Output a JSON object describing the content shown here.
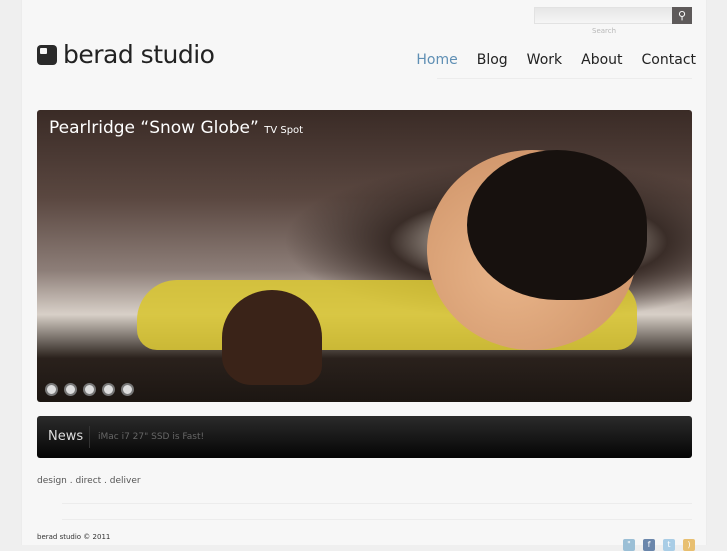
{
  "search": {
    "label": "Search",
    "button_icon": "search-icon"
  },
  "logo": {
    "text": "berad studio"
  },
  "nav": [
    {
      "label": "Home",
      "active": true
    },
    {
      "label": "Blog"
    },
    {
      "label": "Work"
    },
    {
      "label": "About"
    },
    {
      "label": "Contact"
    }
  ],
  "slider": {
    "title": "Pearlridge “Snow Globe”",
    "subtitle": "TV Spot",
    "slides": 5
  },
  "news": {
    "label": "News",
    "headline": "iMac i7 27\" SSD is Fast!"
  },
  "tagline": "design . direct . deliver",
  "footer": {
    "copyright": "berad studio © 2011",
    "social": [
      "delicious-icon",
      "facebook-icon",
      "twitter-icon",
      "rss-icon"
    ]
  },
  "colors": {
    "accent": "#5f8fb4"
  }
}
